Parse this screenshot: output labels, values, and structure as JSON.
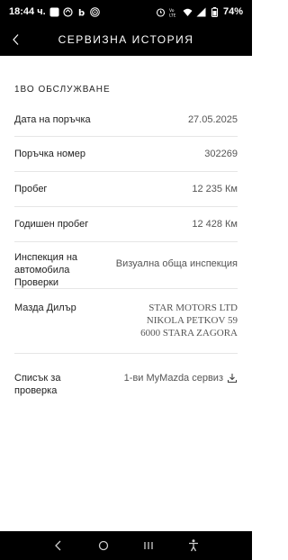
{
  "status_bar": {
    "time": "18:44 ч.",
    "battery": "74%",
    "network_label": "Vo LTE"
  },
  "header": {
    "title": "СЕРВИЗНА ИСТОРИЯ"
  },
  "section": {
    "title": "1ВО ОБСЛУЖВАНЕ"
  },
  "rows": {
    "order_date": {
      "label": "Дата на поръчка",
      "value": "27.05.2025"
    },
    "order_number": {
      "label": "Поръчка номер",
      "value": "302269"
    },
    "mileage": {
      "label": "Пробег",
      "value": "12 235 Км"
    },
    "annual_mileage": {
      "label": "Годишен пробег",
      "value": "12 428 Км"
    },
    "inspection": {
      "label": "Инспекция на автомобила Проверки",
      "value": "Визуална  обща инспекция"
    },
    "dealer": {
      "label": "Мазда Дилър",
      "line1": "STAR MOTORS LTD",
      "line2": "NIKOLA PETKOV 59",
      "line3": "6000 STARA ZAGORA"
    },
    "checklist": {
      "label": "Списък за проверка",
      "value": "1-ви MyMazda сервиз"
    }
  },
  "icons": {
    "back": "chevron-left-icon",
    "download": "download-icon",
    "nav_back": "nav-back-icon",
    "nav_home": "nav-home-icon",
    "nav_recents": "nav-recents-icon",
    "nav_accessibility": "accessibility-icon"
  }
}
